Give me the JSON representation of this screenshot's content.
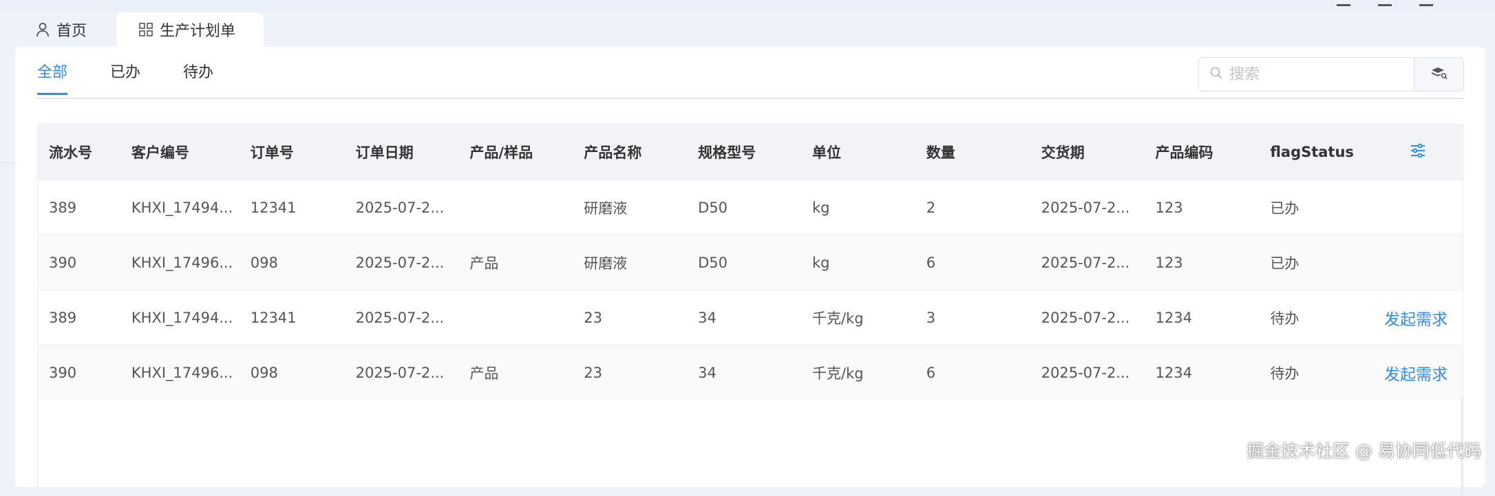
{
  "page_tabs": [
    {
      "label": "首页",
      "icon": "user-icon"
    },
    {
      "label": "生产计划单",
      "icon": "grid-icon"
    }
  ],
  "sub_tabs": [
    {
      "label": "全部",
      "active": true
    },
    {
      "label": "已办",
      "active": false
    },
    {
      "label": "待办",
      "active": false
    }
  ],
  "search": {
    "placeholder": "搜索",
    "value": ""
  },
  "colors": {
    "accent": "#2d8cf0"
  },
  "table": {
    "headers": [
      "流水号",
      "客户编号",
      "订单号",
      "订单日期",
      "产品/样品",
      "产品名称",
      "规格型号",
      "单位",
      "数量",
      "交货期",
      "产品编码",
      "flagStatus"
    ],
    "rows": [
      {
        "cells": [
          "389",
          "KHXI_17494...",
          "12341",
          "2025-07-2...",
          "",
          "研磨液",
          "D50",
          "kg",
          "2",
          "2025-07-2...",
          "123",
          "已办"
        ],
        "action": ""
      },
      {
        "cells": [
          "390",
          "KHXI_17496...",
          "098",
          "2025-07-2...",
          "产品",
          "研磨液",
          "D50",
          "kg",
          "6",
          "2025-07-2...",
          "123",
          "已办"
        ],
        "action": ""
      },
      {
        "cells": [
          "389",
          "KHXI_17494...",
          "12341",
          "2025-07-2...",
          "",
          "23",
          "34",
          "千克/kg",
          "3",
          "2025-07-2...",
          "1234",
          "待办"
        ],
        "action": "发起需求"
      },
      {
        "cells": [
          "390",
          "KHXI_17496...",
          "098",
          "2025-07-2...",
          "产品",
          "23",
          "34",
          "千克/kg",
          "6",
          "2025-07-2...",
          "1234",
          "待办"
        ],
        "action": "发起需求"
      }
    ]
  },
  "watermark": "掘金技术社区 @ 易协同低代码"
}
